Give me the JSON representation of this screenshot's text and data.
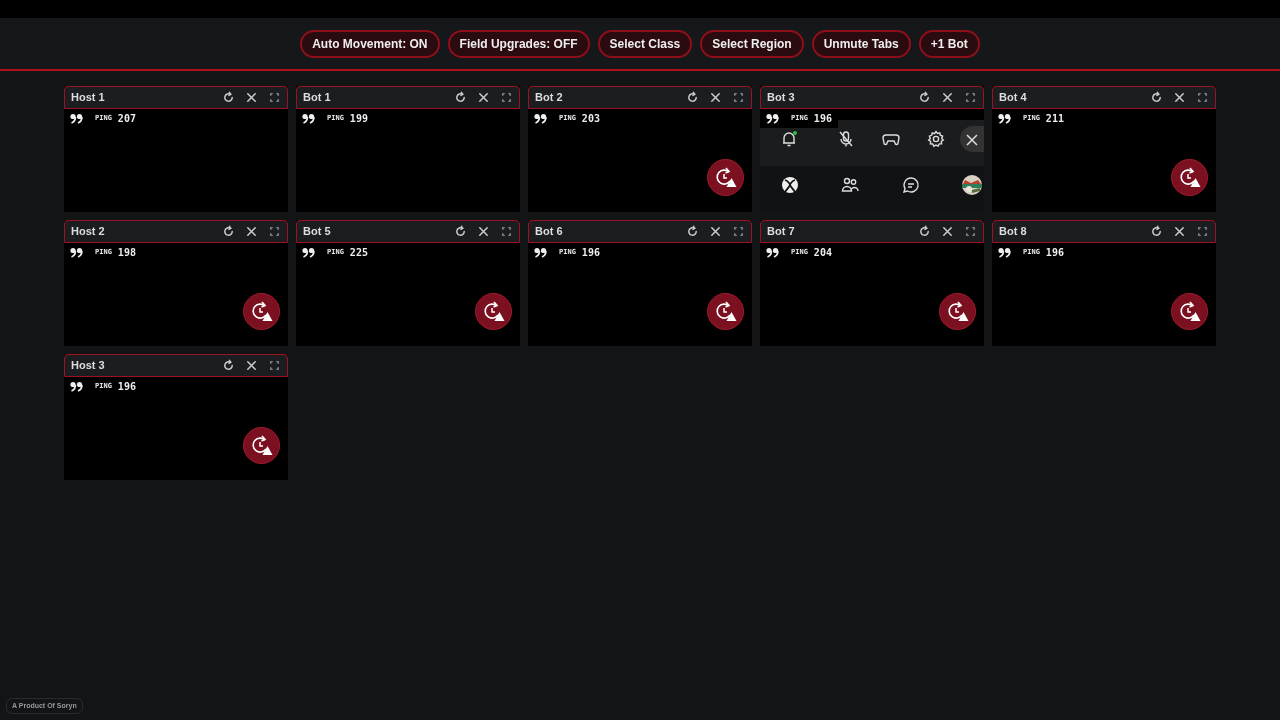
{
  "toolbar": {
    "buttons": [
      {
        "label": "Auto Movement: ON"
      },
      {
        "label": "Field Upgrades: OFF"
      },
      {
        "label": "Select Class"
      },
      {
        "label": "Select Region"
      },
      {
        "label": "Unmute Tabs"
      },
      {
        "label": "+1 Bot"
      }
    ]
  },
  "tiles": [
    {
      "title": "Host 1",
      "ping_label": "PING",
      "ping": "207",
      "alert": false,
      "kind": "stream"
    },
    {
      "title": "Bot 1",
      "ping_label": "PING",
      "ping": "199",
      "alert": false,
      "kind": "stream"
    },
    {
      "title": "Bot 2",
      "ping_label": "PING",
      "ping": "203",
      "alert": true,
      "kind": "stream"
    },
    {
      "title": "Bot 3",
      "ping_label": "PING",
      "ping": "196",
      "alert": false,
      "kind": "game-bar"
    },
    {
      "title": "Bot 4",
      "ping_label": "PING",
      "ping": "211",
      "alert": true,
      "kind": "stream"
    },
    {
      "title": "Host 2",
      "ping_label": "PING",
      "ping": "198",
      "alert": true,
      "kind": "stream"
    },
    {
      "title": "Bot 5",
      "ping_label": "PING",
      "ping": "225",
      "alert": true,
      "kind": "stream"
    },
    {
      "title": "Bot 6",
      "ping_label": "PING",
      "ping": "196",
      "alert": true,
      "kind": "stream"
    },
    {
      "title": "Bot 7",
      "ping_label": "PING",
      "ping": "204",
      "alert": true,
      "kind": "stream"
    },
    {
      "title": "Bot 8",
      "ping_label": "PING",
      "ping": "196",
      "alert": true,
      "kind": "stream"
    },
    {
      "title": "Host 3",
      "ping_label": "PING",
      "ping": "196",
      "alert": true,
      "kind": "stream"
    }
  ],
  "footer": {
    "text": "A Product Of Soryn"
  }
}
